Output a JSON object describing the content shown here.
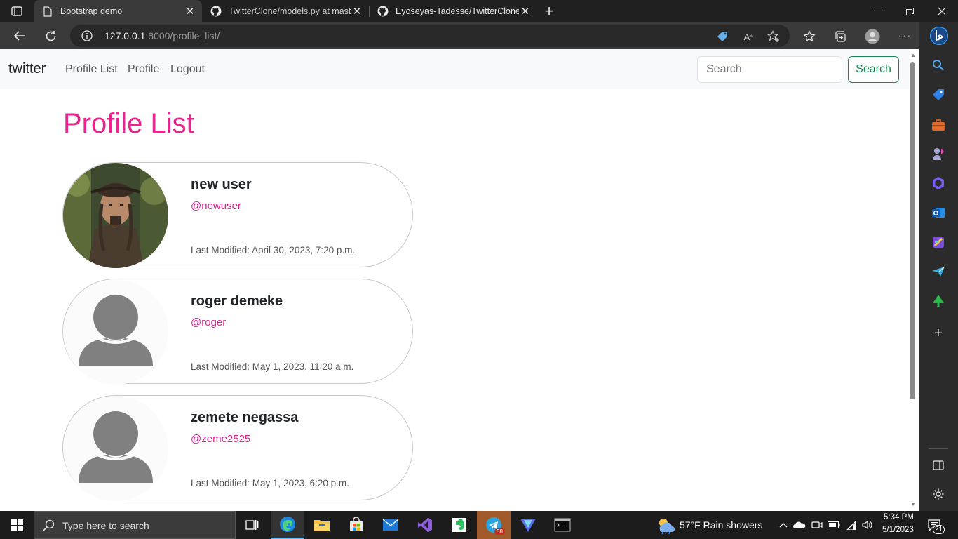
{
  "browser": {
    "tabs": [
      {
        "title": "Bootstrap demo",
        "active": true
      },
      {
        "title": "TwitterClone/models.py at maste",
        "active": false
      },
      {
        "title": "Eyoseyas-Tadesse/TwitterClone: S",
        "active": false
      }
    ],
    "address": {
      "host": "127.0.0.1",
      "path": ":8000/profile_list/"
    },
    "new_tab_label": "+",
    "menu_label": "···"
  },
  "site": {
    "brand": "twitter",
    "nav": [
      "Profile List",
      "Profile",
      "Logout"
    ],
    "search_placeholder": "Search",
    "search_button": "Search"
  },
  "main": {
    "title": "Profile List",
    "profiles": [
      {
        "name": "new user",
        "handle": "@newuser",
        "modified": "Last Modified: April 30, 2023, 7:20 p.m.",
        "avatar": "photo"
      },
      {
        "name": "roger demeke",
        "handle": "@roger",
        "modified": "Last Modified: May 1, 2023, 11:20 a.m.",
        "avatar": "default"
      },
      {
        "name": "zemete negassa",
        "handle": "@zeme2525",
        "modified": "Last Modified: May 1, 2023, 6:20 p.m.",
        "avatar": "default"
      }
    ]
  },
  "taskbar": {
    "search_placeholder": "Type here to search",
    "telegram_badge": "58",
    "weather": "57°F  Rain showers",
    "time": "5:34 PM",
    "date": "5/1/2023",
    "notifications": "21"
  },
  "colors": {
    "accent": "#e8248e",
    "search_button": "#198754",
    "browser_dark": "#202020"
  }
}
